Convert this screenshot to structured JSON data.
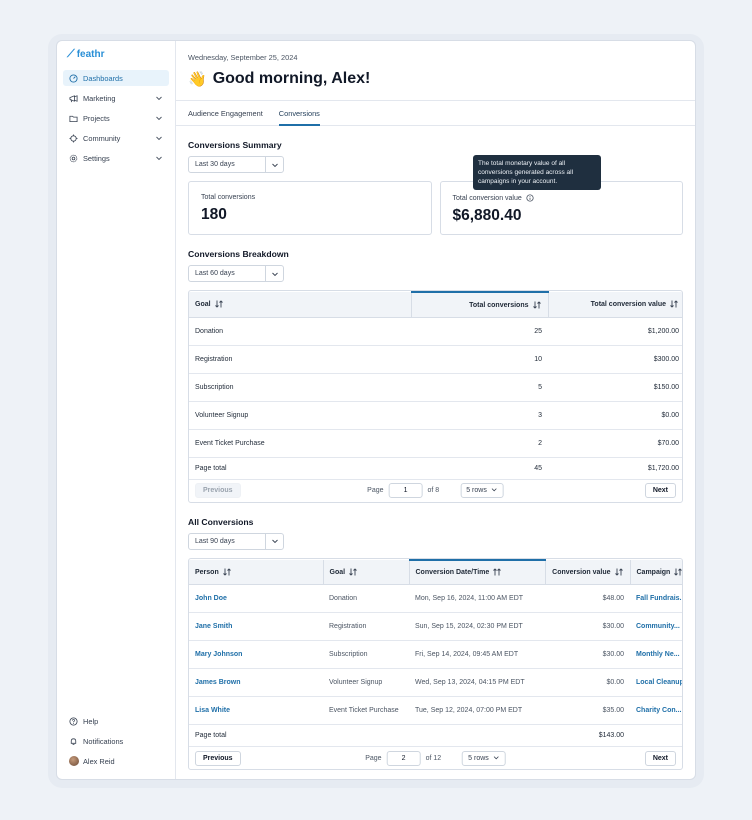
{
  "app": {
    "logo_text": "feathr"
  },
  "sidebar": {
    "items": [
      {
        "label": "Dashboards",
        "icon": "dashboard-icon",
        "active": true
      },
      {
        "label": "Marketing",
        "icon": "megaphone-icon"
      },
      {
        "label": "Projects",
        "icon": "folder-icon"
      },
      {
        "label": "Community",
        "icon": "community-icon"
      },
      {
        "label": "Settings",
        "icon": "gear-icon"
      }
    ],
    "bottom": {
      "help": "Help",
      "notifications": "Notifications",
      "user": "Alex Reid"
    }
  },
  "header": {
    "date": "Wednesday, September 25, 2024",
    "wave": "👋",
    "greeting": "Good morning, Alex!"
  },
  "tabs": [
    {
      "label": "Audience Engagement"
    },
    {
      "label": "Conversions",
      "active": true
    }
  ],
  "summary": {
    "title": "Conversions Summary",
    "range": "Last 30 days",
    "total_conversions_label": "Total conversions",
    "total_conversions": "180",
    "total_value_label": "Total conversion value",
    "total_value": "$6,880.40",
    "tooltip": "The total monetary value of all conversions generated across all campaigns in your account."
  },
  "breakdown": {
    "title": "Conversions Breakdown",
    "range": "Last 60 days",
    "headers": {
      "goal": "Goal",
      "total": "Total conversions",
      "value": "Total conversion value"
    },
    "rows": [
      {
        "goal": "Donation",
        "total": "25",
        "value": "$1,200.00"
      },
      {
        "goal": "Registration",
        "total": "10",
        "value": "$300.00"
      },
      {
        "goal": "Subscription",
        "total": "5",
        "value": "$150.00"
      },
      {
        "goal": "Volunteer Signup",
        "total": "3",
        "value": "$0.00"
      },
      {
        "goal": "Event Ticket Purchase",
        "total": "2",
        "value": "$70.00"
      }
    ],
    "page_total": {
      "label": "Page total",
      "total": "45",
      "value": "$1,720.00"
    },
    "pager": {
      "prev": "Previous",
      "page_label": "Page",
      "page": "1",
      "of": "of 8",
      "rows": "5 rows",
      "next": "Next"
    }
  },
  "all": {
    "title": "All Conversions",
    "range": "Last 90 days",
    "headers": {
      "person": "Person",
      "goal": "Goal",
      "date": "Conversion Date/Time",
      "value": "Conversion value",
      "campaign": "Campaign"
    },
    "rows": [
      {
        "person": "John Doe",
        "goal": "Donation",
        "date": "Mon, Sep 16, 2024, 11:00 AM EDT",
        "value": "$48.00",
        "campaign": "Fall Fundrais..."
      },
      {
        "person": "Jane Smith",
        "goal": "Registration",
        "date": "Sun, Sep 15, 2024, 02:30 PM EDT",
        "value": "$30.00",
        "campaign": "Community..."
      },
      {
        "person": "Mary Johnson",
        "goal": "Subscription",
        "date": "Fri, Sep 14, 2024, 09:45 AM EDT",
        "value": "$30.00",
        "campaign": "Monthly Ne..."
      },
      {
        "person": "James Brown",
        "goal": "Volunteer Signup",
        "date": "Wed, Sep 13, 2024, 04:15 PM EDT",
        "value": "$0.00",
        "campaign": "Local Cleanup"
      },
      {
        "person": "Lisa White",
        "goal": "Event Ticket Purchase",
        "date": "Tue, Sep 12, 2024, 07:00 PM EDT",
        "value": "$35.00",
        "campaign": "Charity Con..."
      }
    ],
    "page_total": {
      "label": "Page total",
      "value": "$143.00"
    },
    "pager": {
      "prev": "Previous",
      "page_label": "Page",
      "page": "2",
      "of": "of 12",
      "rows": "5 rows",
      "next": "Next"
    }
  },
  "colors": {
    "accent": "#1f6fa8",
    "logo": "#2a8fd6",
    "tooltip_bg": "#1f2f3f"
  }
}
